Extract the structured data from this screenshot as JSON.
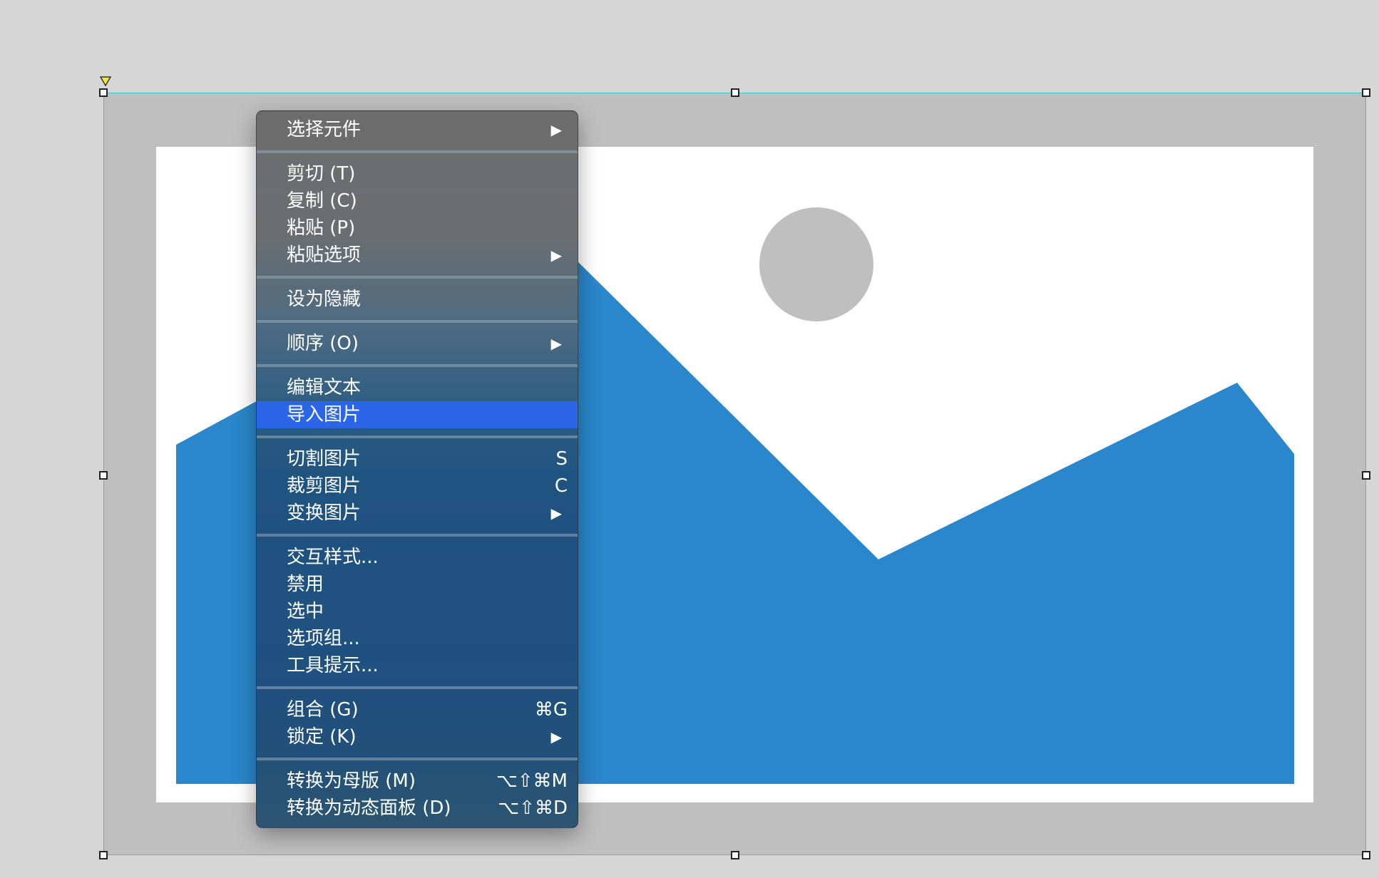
{
  "menu": {
    "items": [
      {
        "label": "选择元件",
        "shortcut": "",
        "submenu": true
      },
      {
        "label": "剪切 (T)",
        "shortcut": "",
        "submenu": false
      },
      {
        "label": "复制 (C)",
        "shortcut": "",
        "submenu": false
      },
      {
        "label": "粘贴 (P)",
        "shortcut": "",
        "submenu": false
      },
      {
        "label": "粘贴选项",
        "shortcut": "",
        "submenu": true
      },
      {
        "label": "设为隐藏",
        "shortcut": "",
        "submenu": false
      },
      {
        "label": "顺序 (O)",
        "shortcut": "",
        "submenu": true
      },
      {
        "label": "编辑文本",
        "shortcut": "",
        "submenu": false
      },
      {
        "label": "导入图片",
        "shortcut": "",
        "submenu": false,
        "selected": true
      },
      {
        "label": "切割图片",
        "shortcut": "S",
        "submenu": false
      },
      {
        "label": "裁剪图片",
        "shortcut": "C",
        "submenu": false
      },
      {
        "label": "变换图片",
        "shortcut": "",
        "submenu": true
      },
      {
        "label": "交互样式...",
        "shortcut": "",
        "submenu": false
      },
      {
        "label": "禁用",
        "shortcut": "",
        "submenu": false
      },
      {
        "label": "选中",
        "shortcut": "",
        "submenu": false
      },
      {
        "label": "选项组...",
        "shortcut": "",
        "submenu": false
      },
      {
        "label": "工具提示...",
        "shortcut": "",
        "submenu": false
      },
      {
        "label": "组合 (G)",
        "shortcut": "⌘G",
        "submenu": false
      },
      {
        "label": "锁定 (K)",
        "shortcut": "",
        "submenu": true
      },
      {
        "label": "转换为母版 (M)",
        "shortcut": "⌥⇧⌘M",
        "submenu": false
      },
      {
        "label": "转换为动态面板 (D)",
        "shortcut": "⌥⇧⌘D",
        "submenu": false
      }
    ],
    "submenu_arrow": "▶"
  },
  "colors": {
    "canvas": "#d6d6d6",
    "frame": "#bfbfbf",
    "selection_outline": "#3cc3c9",
    "mountain": "#2b87cb",
    "sun": "#bfbfbf",
    "menu_highlight": "#2b66e8"
  },
  "icons": [
    "image-placeholder-icon",
    "anchor-triangle-icon",
    "submenu-arrow-icon"
  ]
}
